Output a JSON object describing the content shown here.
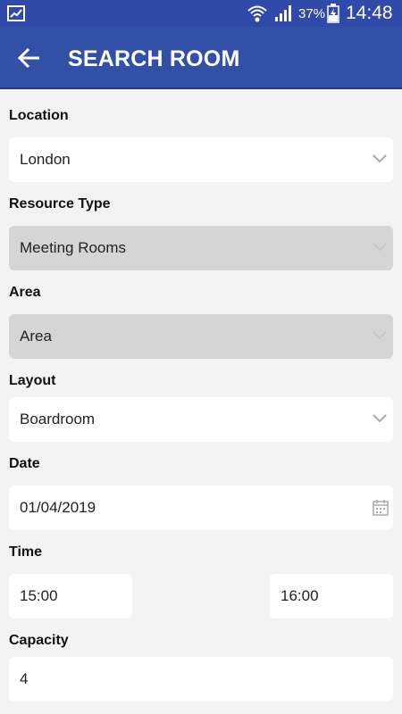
{
  "status_bar": {
    "battery_percent": "37%",
    "time": "14:48",
    "icons": [
      "gallery-icon",
      "wifi-icon",
      "signal-icon",
      "battery-charging-icon"
    ]
  },
  "header": {
    "title": "SEARCH ROOM",
    "back_icon": "arrow-left-icon"
  },
  "form": {
    "location": {
      "label": "Location",
      "value": "London"
    },
    "resource_type": {
      "label": "Resource Type",
      "value": "Meeting Rooms"
    },
    "area": {
      "label": "Area",
      "value": "Area"
    },
    "layout": {
      "label": "Layout",
      "value": "Boardroom"
    },
    "date": {
      "label": "Date",
      "value": "01/04/2019"
    },
    "time": {
      "label": "Time",
      "start": "15:00",
      "end": "16:00"
    },
    "capacity": {
      "label": "Capacity",
      "value": "4"
    }
  },
  "colors": {
    "primary": "#3150a6",
    "status_bar": "#2f4aa8",
    "background": "#f3f3f3",
    "disabled_field": "#d5d5d5"
  }
}
